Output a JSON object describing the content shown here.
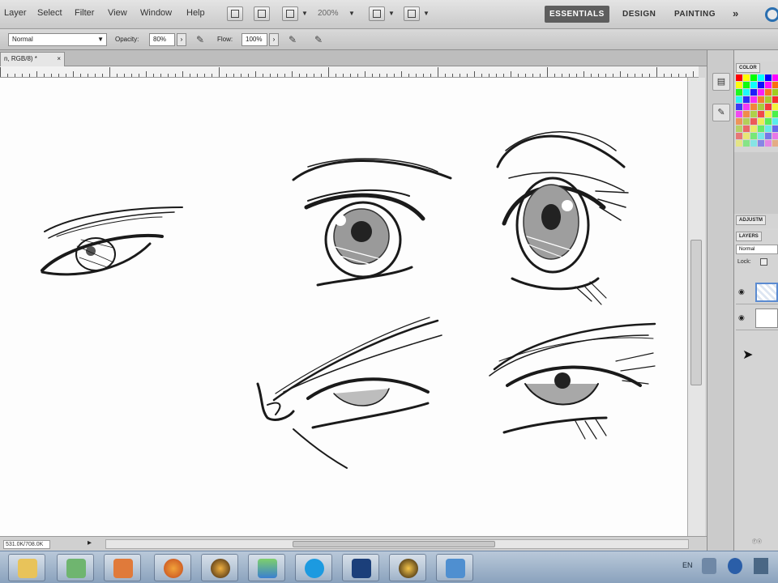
{
  "menu": {
    "items": [
      "Layer",
      "Select",
      "Filter",
      "View",
      "Window",
      "Help"
    ],
    "zoom_level": "200%",
    "workspaces": [
      "ESSENTIALS",
      "DESIGN",
      "PAINTING"
    ],
    "more_label": "»"
  },
  "options": {
    "mode_value": "Normal",
    "opacity_label": "Opacity:",
    "opacity_value": "80%",
    "flow_label": "Flow:",
    "flow_value": "100%"
  },
  "document": {
    "tab_title": "n, RGB/8) *",
    "tab_close": "×",
    "status_text": "531.0K/708.0K"
  },
  "panels": {
    "color_tab": "COLOR",
    "adjust_tab": "ADJUSTM",
    "layers_tab": "LAYERS",
    "layers_blend": "Normal",
    "lock_label": "Lock:",
    "footer_label": "ⓕⓧ"
  },
  "taskbar": {
    "apps": [
      "explorer",
      "recycle",
      "media",
      "firefox",
      "winamp",
      "messenger",
      "skype",
      "photoshop",
      "vlc",
      "network"
    ],
    "language": "EN"
  },
  "colors": {
    "accent": "#5e5e5e",
    "swatches": [
      "#ff0000",
      "#ffff00",
      "#00ff00",
      "#00ffff",
      "#0000ff",
      "#ff00ff",
      "#ff6600",
      "#99cc00"
    ]
  },
  "icons": {
    "cursor": "arrow-cursor-icon"
  }
}
